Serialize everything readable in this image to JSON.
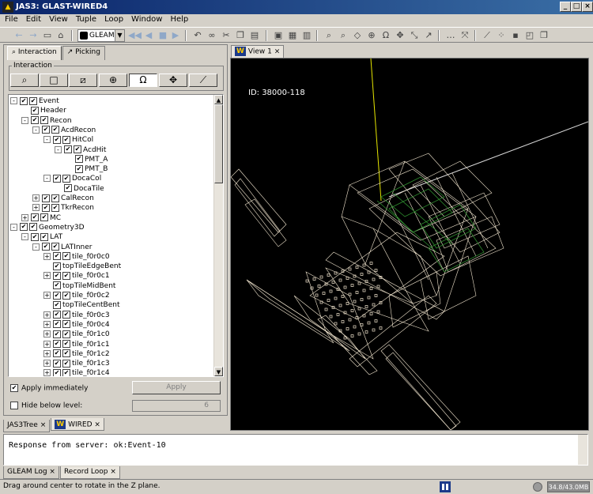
{
  "window": {
    "title": "JAS3: GLAST-WIRED4",
    "app_icon": "JAS3"
  },
  "menu": [
    "File",
    "Edit",
    "View",
    "Tuple",
    "Loop",
    "Window",
    "Help"
  ],
  "toolbar": {
    "combo_value": "GLEAM"
  },
  "left_tabs": {
    "interaction": "Interaction",
    "picking": "Picking"
  },
  "interaction_group": "Interaction",
  "interaction_buttons": [
    "zoom-icon",
    "box-select-icon",
    "pan-diagonal-icon",
    "globe-rotate-icon",
    "rotate-z-icon",
    "translate-icon",
    "measure-icon"
  ],
  "tree": [
    {
      "label": "Event"
    },
    {
      "label": "Header"
    },
    {
      "label": "Recon"
    },
    {
      "label": "AcdRecon"
    },
    {
      "label": "HitCol"
    },
    {
      "label": "AcdHit"
    },
    {
      "label": "PMT_A"
    },
    {
      "label": "PMT_B"
    },
    {
      "label": "DocaCol"
    },
    {
      "label": "DocaTile"
    },
    {
      "label": "CalRecon"
    },
    {
      "label": "TkrRecon"
    },
    {
      "label": "MC"
    },
    {
      "label": "Geometry3D"
    },
    {
      "label": "LAT"
    },
    {
      "label": "LATInner"
    },
    {
      "label": "tile_f0r0c0"
    },
    {
      "label": "topTileEdgeBent"
    },
    {
      "label": "tile_f0r0c1"
    },
    {
      "label": "topTileMidBent"
    },
    {
      "label": "tile_f0r0c2"
    },
    {
      "label": "topTileCentBent"
    },
    {
      "label": "tile_f0r0c3"
    },
    {
      "label": "tile_f0r0c4"
    },
    {
      "label": "tile_f0r1c0"
    },
    {
      "label": "tile_f0r1c1"
    },
    {
      "label": "tile_f0r1c2"
    },
    {
      "label": "tile_f0r1c3"
    },
    {
      "label": "tile_f0r1c4"
    }
  ],
  "apply_immediately": {
    "label": "Apply immediately",
    "checked": true
  },
  "apply_button": "Apply",
  "hide_below": {
    "label": "Hide below level:",
    "checked": false,
    "value": "6"
  },
  "left_bottom_tabs": [
    "JAS3Tree",
    "WIRED"
  ],
  "view_tab": "View 1",
  "view_id": "ID: 38000-118",
  "log": {
    "text": "Response from server: ok:Event-10"
  },
  "log_tabs": [
    "GLEAM Log",
    "Record Loop"
  ],
  "status": {
    "text": "Drag around center to rotate in the Z plane.",
    "memory": "34.8/43.0MB"
  }
}
